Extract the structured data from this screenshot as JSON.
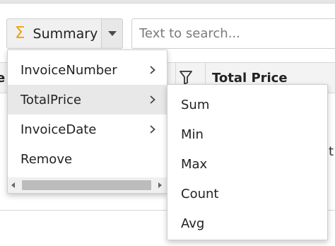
{
  "toolbar": {
    "summary_label": "Summary",
    "summary_icon": "sigma-icon",
    "search_placeholder": "Text to search..."
  },
  "grid": {
    "columns": [
      "e",
      "Total Price"
    ],
    "partial_cell_text": "t"
  },
  "menu": {
    "items": [
      {
        "label": "InvoiceNumber",
        "has_submenu": true,
        "highlighted": false
      },
      {
        "label": "TotalPrice",
        "has_submenu": true,
        "highlighted": true
      },
      {
        "label": "InvoiceDate",
        "has_submenu": true,
        "highlighted": false
      },
      {
        "label": "Remove",
        "has_submenu": false,
        "highlighted": false
      }
    ]
  },
  "submenu": {
    "items": [
      "Sum",
      "Min",
      "Max",
      "Count",
      "Avg"
    ]
  },
  "colors": {
    "sigma": "#f0a30a",
    "highlight": "#e8e8e8"
  }
}
